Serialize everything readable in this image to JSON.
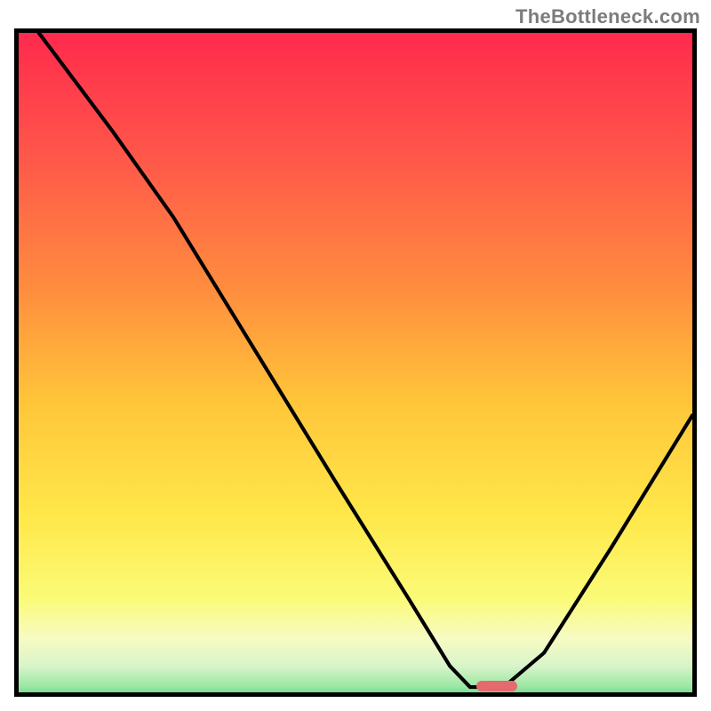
{
  "watermark": "TheBottleneck.com",
  "colors": {
    "frame_border": "#000000",
    "curve_stroke": "#000000",
    "marker_fill": "#e46a6f",
    "gradient_stops": [
      {
        "offset": 0.0,
        "color": "#ff2a4d"
      },
      {
        "offset": 0.18,
        "color": "#ff564a"
      },
      {
        "offset": 0.38,
        "color": "#ff8d3e"
      },
      {
        "offset": 0.55,
        "color": "#ffc63a"
      },
      {
        "offset": 0.72,
        "color": "#ffe84a"
      },
      {
        "offset": 0.84,
        "color": "#fbfb78"
      },
      {
        "offset": 0.9,
        "color": "#f6fbc4"
      },
      {
        "offset": 0.94,
        "color": "#d8f4c9"
      },
      {
        "offset": 0.97,
        "color": "#9ce7a4"
      },
      {
        "offset": 1.0,
        "color": "#31c972"
      }
    ]
  },
  "chart_data": {
    "type": "line",
    "title": "",
    "xlabel": "",
    "ylabel": "",
    "xlim": [
      0,
      100
    ],
    "ylim": [
      0,
      100
    ],
    "note": "Axes are unlabeled in the image; x/y are normalized 0–100 as a proportion of the plot area (origin at bottom-left). The curve depicts a V-shape with its minimum near x≈70 reaching y≈0, and a small salmon marker sits on the baseline near the minimum.",
    "series": [
      {
        "name": "curve",
        "points": [
          {
            "x": 3,
            "y": 100
          },
          {
            "x": 14,
            "y": 85
          },
          {
            "x": 23,
            "y": 72
          },
          {
            "x": 35,
            "y": 52
          },
          {
            "x": 47,
            "y": 32
          },
          {
            "x": 58,
            "y": 14
          },
          {
            "x": 64,
            "y": 4
          },
          {
            "x": 67,
            "y": 0.8
          },
          {
            "x": 72,
            "y": 0.8
          },
          {
            "x": 78,
            "y": 6
          },
          {
            "x": 88,
            "y": 22
          },
          {
            "x": 100,
            "y": 42
          }
        ]
      }
    ],
    "marker": {
      "x": 71,
      "y": 1,
      "w": 6,
      "h": 1.6
    }
  }
}
